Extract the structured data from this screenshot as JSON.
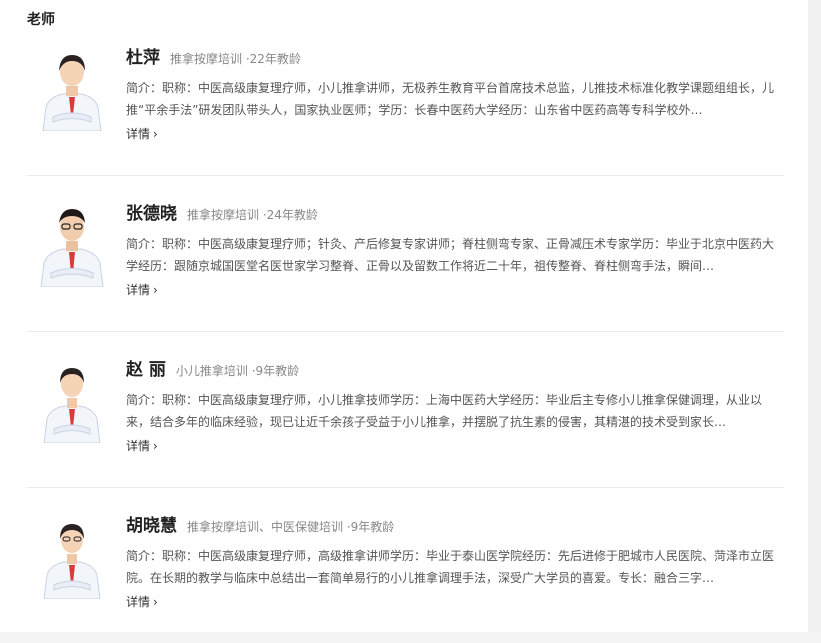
{
  "section": {
    "title": "老师"
  },
  "teachers": [
    {
      "name": "杜萍",
      "meta": "推拿按摩培训 ·22年教龄",
      "intro": "简介：职称：中医高级康复理疗师，小儿推拿讲师，无极养生教育平台首席技术总监，儿推技术标准化教学课题组组长，儿推“平余手法”研发团队带头人，国家执业医师；学历：长春中医药大学经历：山东省中医药高等专科学校外…",
      "more": "详情"
    },
    {
      "name": "张德晓",
      "meta": "推拿按摩培训 ·24年教龄",
      "intro": "简介：职称：中医高级康复理疗师；针灸、产后修复专家讲师；脊柱侧弯专家、正骨减压术专家学历：毕业于北京中医药大学经历：跟随京城国医堂名医世家学习整脊、正骨以及留数工作将近二十年，祖传整脊、脊柱侧弯手法，瞬间…",
      "more": "详情"
    },
    {
      "name": "赵 丽",
      "meta": "小儿推拿培训 ·9年教龄",
      "intro": "简介：职称：中医高级康复理疗师，小儿推拿技师学历：上海中医药大学经历：毕业后主专修小儿推拿保健调理，从业以来，结合多年的临床经验，现已让近千余孩子受益于小儿推拿，并摆脱了抗生素的侵害，其精湛的技术受到家长…",
      "more": "详情"
    },
    {
      "name": "胡晓慧",
      "meta": "推拿按摩培训、中医保健培训 ·9年教龄",
      "intro": "简介：职称：中医高级康复理疗师，高级推拿讲师学历：毕业于泰山医学院经历：先后进修于肥城市人民医院、菏泽市立医院。在长期的教学与临床中总结出一套简单易行的小儿推拿调理手法，深受广大学员的喜爱。专长：融合三字…",
      "more": "详情"
    }
  ]
}
